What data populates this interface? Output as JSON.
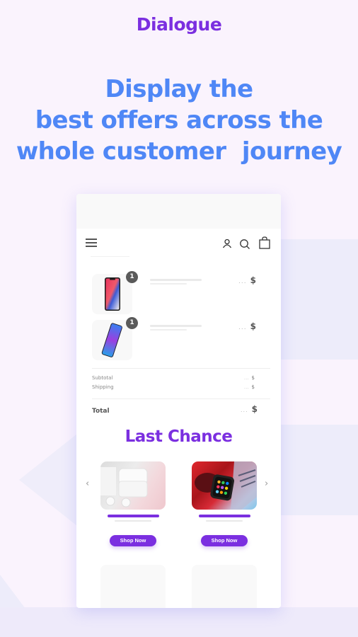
{
  "brand": {
    "logo_text": "Dialogue",
    "accent_color": "#7b2fe0",
    "headline_color": "#4f87f6"
  },
  "headline": {
    "lines": [
      "Display the",
      "best offers across the",
      "whole customer  journey"
    ]
  },
  "phone": {
    "nav": {
      "icons": [
        "menu-icon",
        "user-icon",
        "search-icon",
        "shopping-bag-icon"
      ]
    },
    "cart": {
      "items": [
        {
          "product": "smartphone (iPhone X style)",
          "quantity": "1",
          "price_placeholder": "...",
          "currency": "$"
        },
        {
          "product": "smartphone (colorful gradient)",
          "quantity": "1",
          "price_placeholder": "...",
          "currency": "$"
        }
      ],
      "summary": [
        {
          "label": "Subtotal",
          "placeholder": "...",
          "currency": "$"
        },
        {
          "label": "Shipping",
          "placeholder": "...",
          "currency": "$"
        }
      ],
      "total": {
        "label": "Total",
        "placeholder": "...",
        "currency": "$"
      }
    },
    "upsell": {
      "title": "Last Chance",
      "prev_icon": "‹",
      "next_icon": "›",
      "products": [
        {
          "image": "wireless earbuds with charging case",
          "button_label": "Shop Now"
        },
        {
          "image": "smartwatch on laptop",
          "button_label": "Shop Now"
        }
      ]
    }
  }
}
